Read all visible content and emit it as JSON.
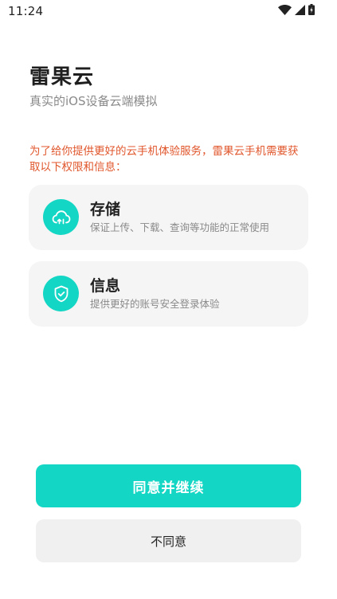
{
  "status_bar": {
    "time": "11:24",
    "icons": [
      "wifi-icon",
      "cellular-signal-icon",
      "battery-charging-icon"
    ]
  },
  "header": {
    "title": "雷果云",
    "subtitle": "真实的iOS设备云端模拟"
  },
  "notice": {
    "text": "为了给你提供更好的云手机体验服务，雷果云手机需要获取以下权限和信息："
  },
  "permissions": [
    {
      "icon": "cloud-upload-icon",
      "title": "存储",
      "description": "保证上传、下载、查询等功能的正常使用"
    },
    {
      "icon": "shield-check-icon",
      "title": "信息",
      "description": "提供更好的账号安全登录体验"
    }
  ],
  "buttons": {
    "agree_label": "同意并继续",
    "disagree_label": "不同意"
  },
  "colors": {
    "accent": "#14d6c4",
    "notice": "#e0562b",
    "card_bg": "#f5f5f5",
    "secondary_button_bg": "#f0f0f0"
  }
}
